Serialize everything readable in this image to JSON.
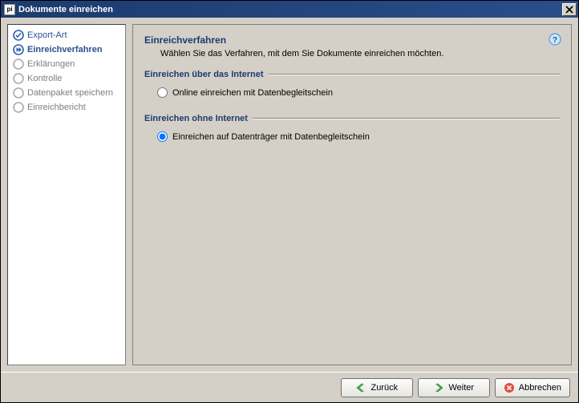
{
  "window": {
    "title": "Dokumente einreichen"
  },
  "sidebar": {
    "items": [
      {
        "label": "Export-Art",
        "state": "done"
      },
      {
        "label": "Einreichverfahren",
        "state": "current"
      },
      {
        "label": "Erklärungen",
        "state": "pending"
      },
      {
        "label": "Kontrolle",
        "state": "pending"
      },
      {
        "label": "Datenpaket speichern",
        "state": "pending"
      },
      {
        "label": "Einreichbericht",
        "state": "pending"
      }
    ]
  },
  "main": {
    "title": "Einreichverfahren",
    "description": "Wählen Sie das Verfahren, mit dem Sie Dokumente einreichen möchten.",
    "group_internet": {
      "legend": "Einreichen über das Internet",
      "option_online": "Online einreichen mit Datenbegleitschein"
    },
    "group_offline": {
      "legend": "Einreichen ohne Internet",
      "option_datentraeger": "Einreichen auf Datenträger mit Datenbegleitschein"
    },
    "selected": "datentraeger"
  },
  "footer": {
    "back": "Zurück",
    "next": "Weiter",
    "cancel": "Abbrechen"
  }
}
